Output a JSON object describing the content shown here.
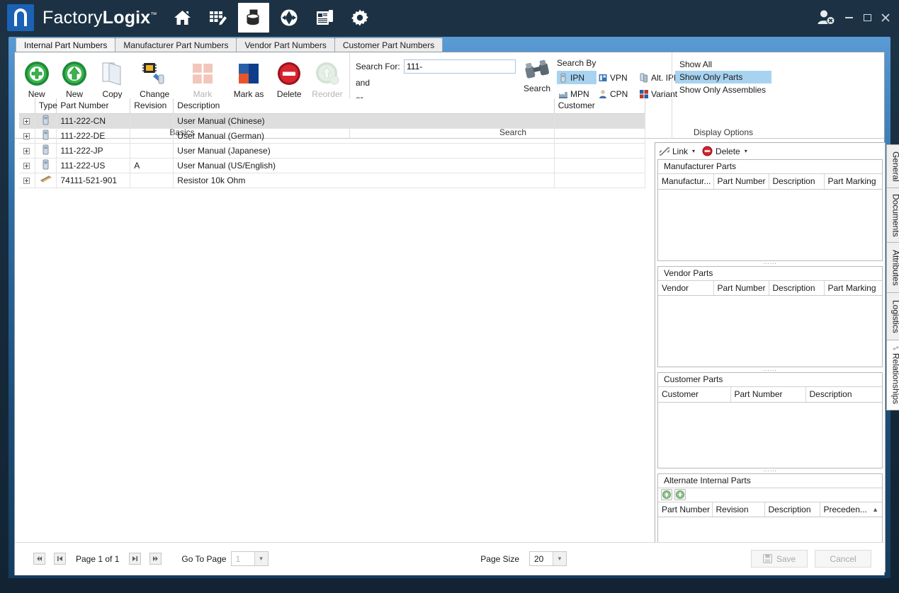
{
  "titlebar": {
    "brand_first": "Factory",
    "brand_second": "Logix",
    "brand_tm": "™",
    "nav_icons": [
      "home-icon",
      "planning-icon",
      "materials-icon",
      "production-icon",
      "reports-icon",
      "settings-icon"
    ],
    "user_icon": "user-logout-icon",
    "minimize": "_",
    "maximize": "□",
    "close": "✕"
  },
  "tabs": [
    {
      "label": "Internal Part Numbers",
      "active": true
    },
    {
      "label": "Manufacturer Part Numbers",
      "active": false
    },
    {
      "label": "Vendor Part Numbers",
      "active": false
    },
    {
      "label": "Customer Part Numbers",
      "active": false
    }
  ],
  "ribbon": {
    "basics": {
      "group_label": "Basics",
      "buttons": [
        {
          "label": "New",
          "icon": "new-plus-icon",
          "caret": "▾",
          "disabled": false
        },
        {
          "label": "New Revision",
          "icon": "new-revision-up-arrow-icon",
          "caret": "",
          "disabled": false
        },
        {
          "label": "Copy",
          "icon": "copy-pages-icon",
          "caret": "",
          "disabled": false
        },
        {
          "label": "Change Part Type",
          "icon": "change-part-type-icon",
          "caret": "▾",
          "disabled": false
        },
        {
          "label": "Mark Assembly as current",
          "icon": "mark-assembly-current-icon",
          "caret": "",
          "disabled": true
        },
        {
          "label": "Mark as Assembly",
          "icon": "mark-as-assembly-icon",
          "caret": "",
          "disabled": false
        },
        {
          "label": "Delete",
          "icon": "delete-circle-icon",
          "caret": "",
          "disabled": false
        },
        {
          "label": "Reorder Revisions",
          "icon": "reorder-revisions-icon",
          "caret": "",
          "disabled": true
        }
      ]
    },
    "search": {
      "group_label": "Search",
      "label_search_for": "Search For:",
      "value_search_for": "111-",
      "placeholder_search_for": "",
      "label_and": "and",
      "label_or": "or",
      "search_button_label": "Search",
      "search_button_icon": "binoculars-icon",
      "search_by_label": "Search By",
      "search_by_options": [
        {
          "label": "IPN",
          "icon": "ipn-icon",
          "selected": true
        },
        {
          "label": "VPN",
          "icon": "vpn-icon",
          "selected": false
        },
        {
          "label": "Alt. IPN",
          "icon": "alt-ipn-icon",
          "selected": false
        },
        {
          "label": "MPN",
          "icon": "mpn-factory-icon",
          "selected": false
        },
        {
          "label": "CPN",
          "icon": "cpn-person-icon",
          "selected": false
        },
        {
          "label": "Variant",
          "icon": "variant-squares-icon",
          "selected": false
        }
      ]
    },
    "display_options": {
      "group_label": "Display Options",
      "items": [
        {
          "label": "Show All",
          "selected": false
        },
        {
          "label": "Show Only Parts",
          "selected": true
        },
        {
          "label": "Show Only Assemblies",
          "selected": false
        }
      ]
    }
  },
  "main_grid": {
    "columns": [
      "",
      "Type",
      "Part Number",
      "Revision",
      "Description",
      "Customer"
    ],
    "rows": [
      {
        "expander": "+",
        "type_icon": "part-icon",
        "part_number": "111-222-CN",
        "revision": "",
        "description": "User Manual (Chinese)",
        "customer": "",
        "selected": true
      },
      {
        "expander": "+",
        "type_icon": "part-icon",
        "part_number": "111-222-DE",
        "revision": "",
        "description": "User Manual (German)",
        "customer": "",
        "selected": false
      },
      {
        "expander": "+",
        "type_icon": "part-icon",
        "part_number": "111-222-JP",
        "revision": "",
        "description": "User Manual (Japanese)",
        "customer": "",
        "selected": false
      },
      {
        "expander": "+",
        "type_icon": "part-icon",
        "part_number": "111-222-US",
        "revision": "A",
        "description": "User Manual (US/English)",
        "customer": "",
        "selected": false
      },
      {
        "expander": "+",
        "type_icon": "resistor-icon",
        "part_number": "74111-521-901",
        "revision": "",
        "description": "Resistor 10k Ohm",
        "customer": "",
        "selected": false
      }
    ]
  },
  "right_panel": {
    "toolbar": {
      "link_label": "Link",
      "link_icon": "link-chain-icon",
      "link_caret": "▾",
      "delete_label": "Delete",
      "delete_icon": "delete-circle-icon",
      "delete_caret": "▾"
    },
    "sections": [
      {
        "title": "Manufacturer Parts",
        "columns": [
          "Manufactur...",
          "Part Number",
          "Description",
          "Part Marking"
        ],
        "rows": []
      },
      {
        "title": "Vendor Parts",
        "columns": [
          "Vendor",
          "Part Number",
          "Description",
          "Part Marking"
        ],
        "rows": []
      },
      {
        "title": "Customer Parts",
        "columns": [
          "Customer",
          "Part Number",
          "Description"
        ],
        "rows": []
      },
      {
        "title": "Alternate Internal Parts",
        "columns": [
          "Part Number",
          "Revision",
          "Description",
          "Preceden..."
        ],
        "rows": [],
        "tools": [
          "move-up-icon",
          "move-down-icon"
        ],
        "sort_arrow": "▲"
      }
    ],
    "vertical_tabs": [
      {
        "label": "General",
        "active": false,
        "icon": ""
      },
      {
        "label": "Documents",
        "active": false,
        "icon": ""
      },
      {
        "label": "Attributes",
        "active": false,
        "icon": ""
      },
      {
        "label": "Logistics",
        "active": false,
        "icon": ""
      },
      {
        "label": "Relationships",
        "active": true,
        "icon": "link-chain-icon"
      }
    ]
  },
  "bottom_bar": {
    "first_page_icon": "first-page-icon",
    "prev_page_icon": "previous-page-icon",
    "page_text": "Page 1 of 1",
    "next_page_icon": "next-page-icon",
    "last_page_icon": "last-page-icon",
    "go_to_page_label": "Go To Page",
    "go_to_page_value": "1",
    "page_size_label": "Page Size",
    "page_size_value": "20",
    "save_label": "Save",
    "save_icon": "save-disk-icon",
    "cancel_label": "Cancel"
  },
  "colors": {
    "brand_blue": "#1b62b5",
    "titlebar": "#1c3244",
    "frame_top": "#5b9bd5",
    "frame_bottom": "#163c5d",
    "selection": "#a8d3f0",
    "row_selected": "#dedede"
  }
}
